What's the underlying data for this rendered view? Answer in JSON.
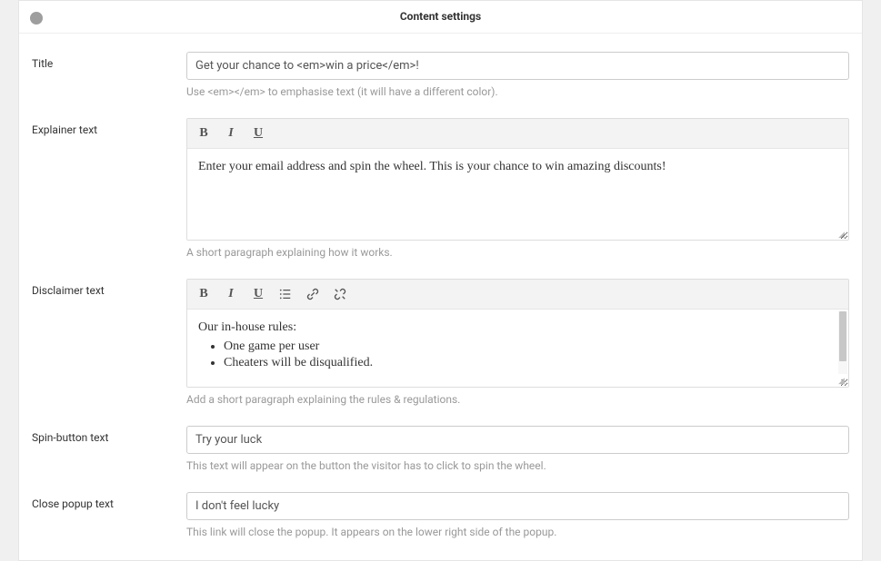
{
  "header": {
    "title": "Content settings"
  },
  "fields": {
    "title": {
      "label": "Title",
      "value": "Get your chance to <em>win a price</em>!",
      "hint": "Use <em></em> to emphasise text (it will have a different color)."
    },
    "explainer": {
      "label": "Explainer text",
      "content": "Enter your email address and spin the wheel. This is your chance to win amazing discounts!",
      "hint": "A short paragraph explaining how it works."
    },
    "disclaimer": {
      "label": "Disclaimer text",
      "intro": "Our in-house rules:",
      "items": [
        "One game per user",
        "Cheaters will be disqualified."
      ],
      "hint": "Add a short paragraph explaining the rules & regulations."
    },
    "spinButton": {
      "label": "Spin-button text",
      "value": "Try your luck",
      "hint": "This text will appear on the button the visitor has to click to spin the wheel."
    },
    "closePopup": {
      "label": "Close popup text",
      "value": "I don't feel lucky",
      "hint": "This link will close the popup. It appears on the lower right side of the popup."
    }
  },
  "toolbar": {
    "bold": "B",
    "italic": "I",
    "underline": "U"
  }
}
